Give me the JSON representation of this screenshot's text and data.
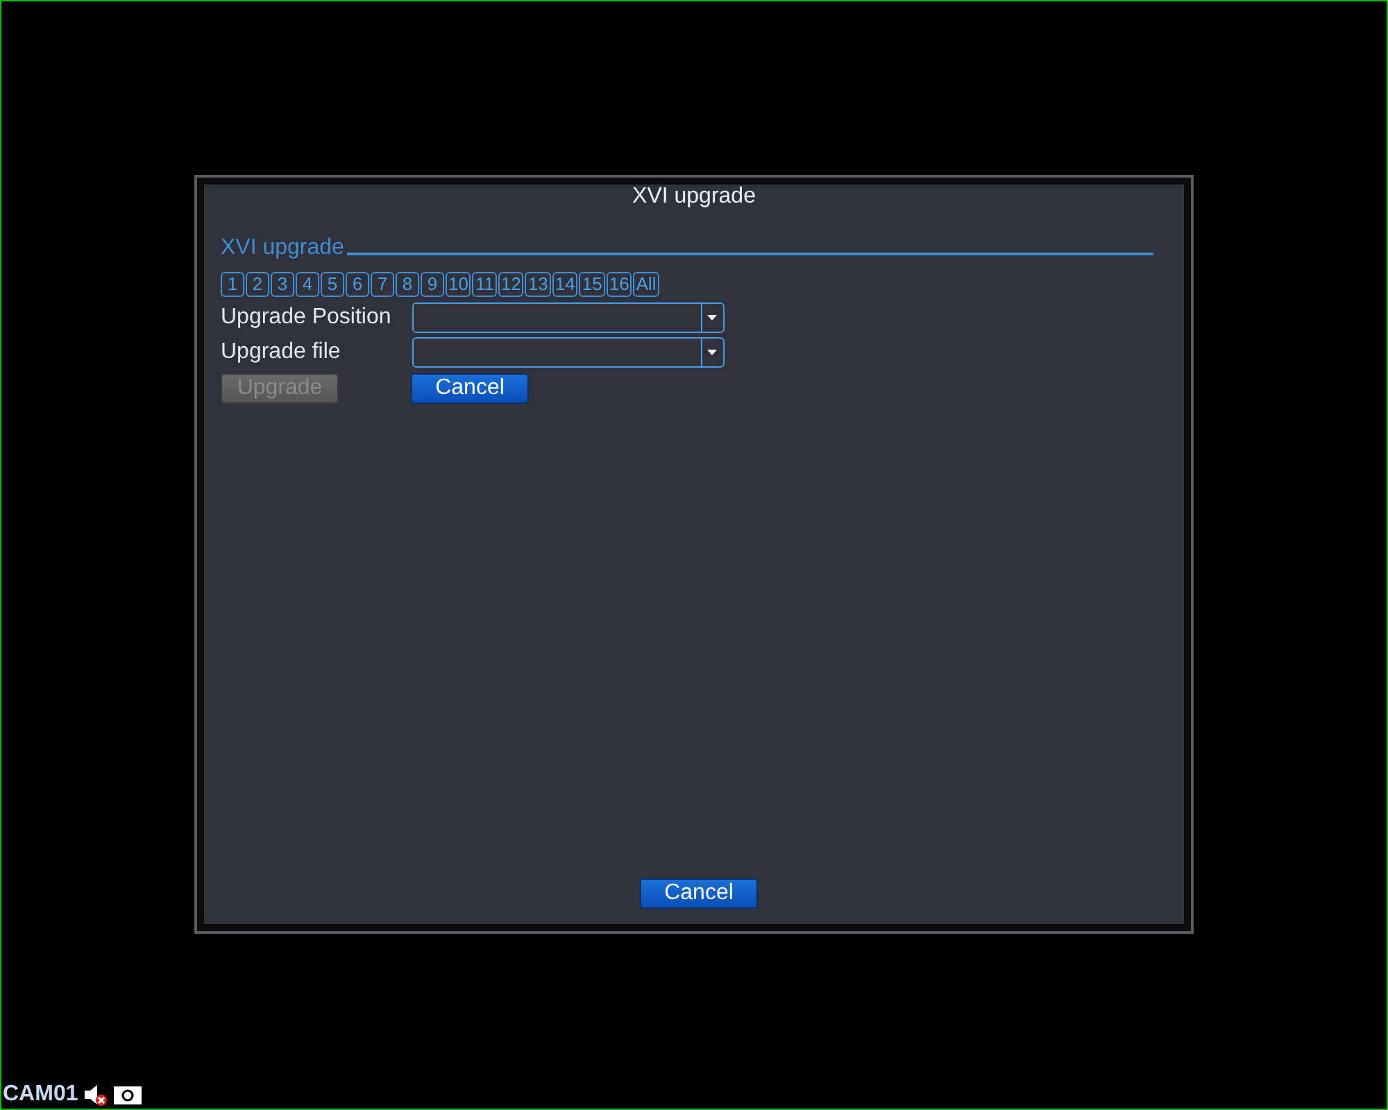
{
  "window": {
    "title": "XVI upgrade"
  },
  "section": {
    "title": "XVI upgrade"
  },
  "channels": [
    "1",
    "2",
    "3",
    "4",
    "5",
    "6",
    "7",
    "8",
    "9",
    "10",
    "11",
    "12",
    "13",
    "14",
    "15",
    "16",
    "All"
  ],
  "fields": [
    {
      "label": "Upgrade Position"
    },
    {
      "label": "Upgrade file"
    }
  ],
  "actions": [
    {
      "label": "Upgrade",
      "disabled": true
    },
    {
      "label": "Cancel",
      "disabled": false
    }
  ],
  "footer_button": {
    "label": "Cancel"
  },
  "camera_overlay": {
    "name": "CAM01",
    "muted": true
  }
}
